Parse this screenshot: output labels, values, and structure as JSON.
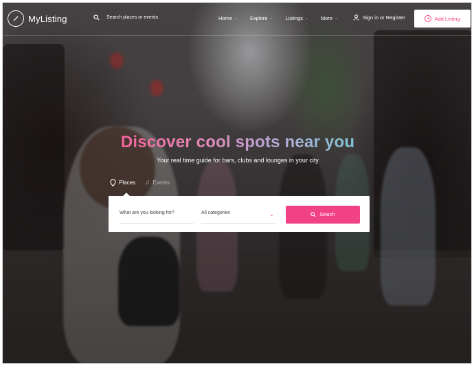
{
  "header": {
    "logo_text": "MyListing",
    "search_placeholder": "Search places or events",
    "nav": [
      {
        "label": "Home"
      },
      {
        "label": "Explore"
      },
      {
        "label": "Listings"
      },
      {
        "label": "More"
      }
    ],
    "signin_label": "Sign in or Register",
    "add_listing_label": "Add Listing"
  },
  "hero": {
    "title": "Discover cool spots near you",
    "subtitle": "Your real time guide for bars, clubs and lounges in your city",
    "tabs": [
      {
        "label": "Places",
        "active": true
      },
      {
        "label": "Events",
        "active": false
      }
    ]
  },
  "search_form": {
    "keyword_placeholder": "What are you looking for?",
    "category_value": "All categories",
    "button_label": "Search"
  },
  "colors": {
    "accent": "#f24286",
    "title_gradient_start": "#f2639a",
    "title_gradient_end": "#7fc7d6"
  },
  "icons": {
    "logo": "compass-icon",
    "search": "search-icon",
    "user": "user-icon",
    "add": "plus-circle-icon",
    "places": "map-pin-icon",
    "events": "music-note-icon",
    "dropdown": "chevron-down-icon"
  }
}
